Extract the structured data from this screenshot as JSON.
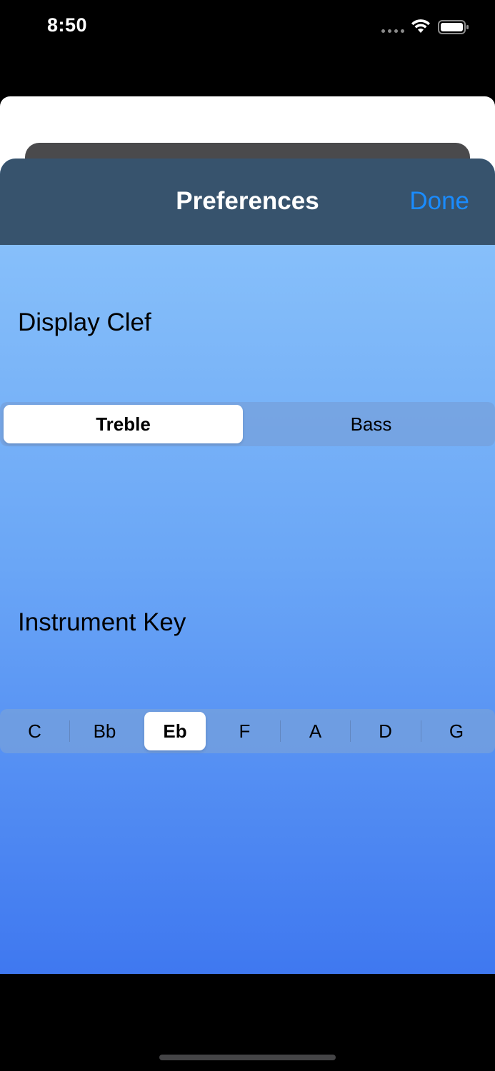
{
  "status_bar": {
    "time": "8:50",
    "icons": [
      "signal-dots-icon",
      "wifi-icon",
      "battery-icon"
    ]
  },
  "nav": {
    "title": "Preferences",
    "done_label": "Done"
  },
  "display_clef": {
    "label": "Display Clef",
    "options": [
      "Treble",
      "Bass"
    ],
    "selected": "Treble"
  },
  "instrument_key": {
    "label": "Instrument Key",
    "options": [
      "C",
      "Bb",
      "Eb",
      "F",
      "A",
      "D",
      "G"
    ],
    "selected": "Eb"
  },
  "colors": {
    "nav_background": "#37536d",
    "done_tint": "#1a8cff",
    "gradient_top": "#8ec6fb",
    "gradient_bottom": "#3f78f0"
  }
}
